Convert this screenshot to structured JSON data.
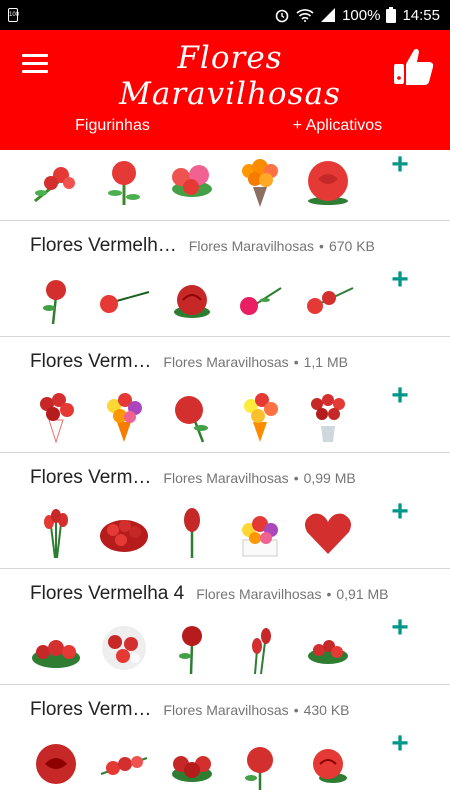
{
  "status_bar": {
    "battery_percent": "100%",
    "time": "14:55",
    "small_badge": "100"
  },
  "app_bar": {
    "title": "Flores Maravilhosas"
  },
  "tabs": [
    {
      "label": "Figurinhas"
    },
    {
      "label": "+ Aplicativos"
    }
  ],
  "colors": {
    "primary": "#ff0000",
    "accent": "#009688",
    "text": "#222222",
    "meta": "#757575"
  },
  "packs": [
    {
      "name": "",
      "publisher": "",
      "size": "",
      "add_icon": "+"
    },
    {
      "name": "Flores Vermelh…",
      "publisher": "Flores Maravilhosas",
      "size": "670 KB",
      "add_icon": "+"
    },
    {
      "name": "Flores Verm…",
      "publisher": "Flores Maravilhosas",
      "size": "1,1 MB",
      "add_icon": "+"
    },
    {
      "name": "Flores Verm…",
      "publisher": "Flores Maravilhosas",
      "size": "0,99 MB",
      "add_icon": "+"
    },
    {
      "name": "Flores Vermelha 4",
      "publisher": "Flores Maravilhosas",
      "size": "0,91 MB",
      "add_icon": "+"
    },
    {
      "name": "Flores Verm…",
      "publisher": "Flores Maravilhosas",
      "size": "430 KB",
      "add_icon": "+"
    }
  ],
  "meta_separator": "•"
}
